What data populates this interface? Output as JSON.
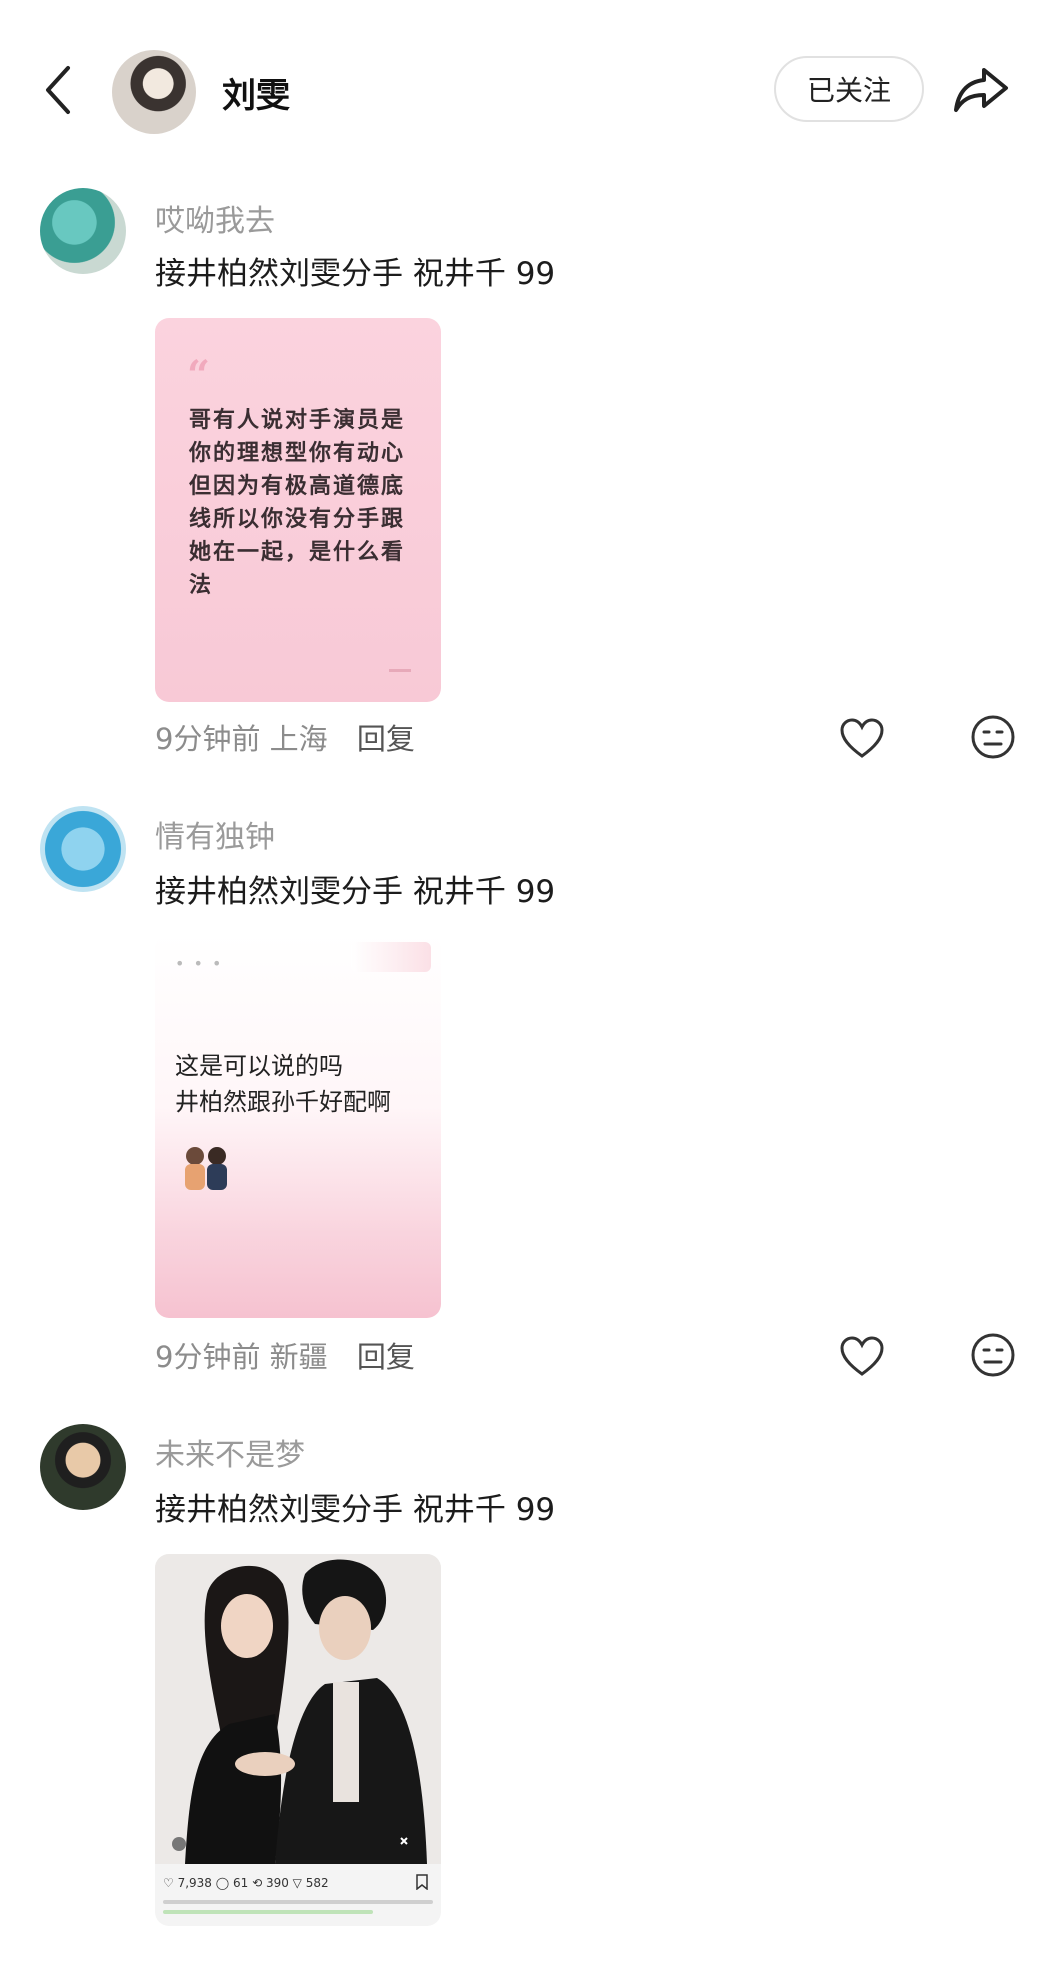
{
  "header": {
    "name": "刘雯",
    "follow_label": "已关注"
  },
  "comments": [
    {
      "user": "哎呦我去",
      "text": "接井柏然刘雯分手 祝井千 99",
      "card_quote": "“",
      "card_text": "哥有人说对手演员是你的理想型你有动心但因为有极高道德底线所以你没有分手跟她在一起，是什么看法",
      "time": "9分钟前",
      "location": "上海",
      "reply": "回复"
    },
    {
      "user": "情有独钟",
      "text": "接井柏然刘雯分手 祝井千 99",
      "card_dots": "• • •",
      "card_line1": "这是可以说的吗",
      "card_line2": "井柏然跟孙千好配啊",
      "time": "9分钟前",
      "location": "新疆",
      "reply": "回复"
    },
    {
      "user": "未来不是梦",
      "text": "接井柏然刘雯分手 祝井千 99",
      "card_stats": "♡ 7,938   ◯ 61   ⟲ 390   ▽ 582"
    }
  ],
  "icons": {
    "back": "chevron-left-icon",
    "share": "share-icon",
    "like": "heart-icon",
    "emoji": "emoji-icon"
  },
  "colors": {
    "card_pink": "#f8c9d6",
    "meta_gray": "#8c8c8c",
    "name_gray": "#9a9a9a"
  }
}
